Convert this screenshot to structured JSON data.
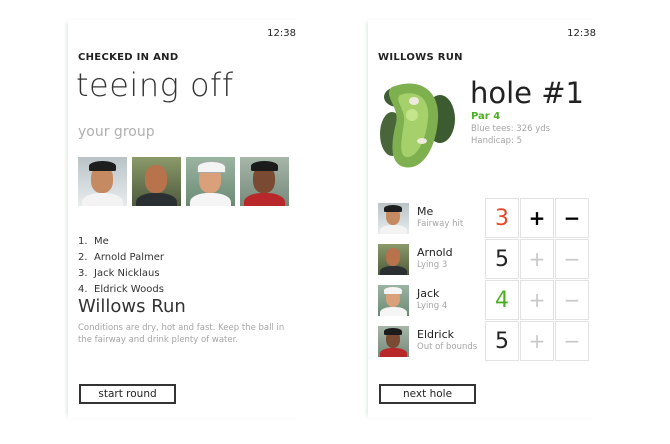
{
  "status": {
    "time": "12:38"
  },
  "screen1": {
    "app_title": "CHECKED IN AND",
    "page_title": "teeing off",
    "section_label": "your group",
    "players": [
      {
        "num": "1.",
        "name": "Me"
      },
      {
        "num": "2.",
        "name": "Arnold Palmer"
      },
      {
        "num": "3.",
        "name": "Jack Nicklaus"
      },
      {
        "num": "4.",
        "name": "Eldrick Woods"
      }
    ],
    "course_name": "Willows Run",
    "conditions": "Conditions are dry, hot and fast. Keep the ball in the fairway and drink plenty of water.",
    "start_button": "start round"
  },
  "screen2": {
    "app_title": "WILLOWS RUN",
    "hole_title": "hole #1",
    "par": "Par 4",
    "blue_tees": "Blue tees: 326 yds",
    "handicap": "Handicap: 5",
    "rows": [
      {
        "name": "Me",
        "status": "Fairway hit",
        "score": "3",
        "score_color": "#e8472a",
        "plus": "+",
        "minus": "−",
        "active": true
      },
      {
        "name": "Arnold",
        "status": "Lying 3",
        "score": "5",
        "score_color": "#222222",
        "plus": "+",
        "minus": "−",
        "active": false
      },
      {
        "name": "Jack",
        "status": "Lying 4",
        "score": "4",
        "score_color": "#4caf22",
        "plus": "+",
        "minus": "−",
        "active": false
      },
      {
        "name": "Eldrick",
        "status": "Out of bounds",
        "score": "5",
        "score_color": "#222222",
        "plus": "+",
        "minus": "−",
        "active": false
      }
    ],
    "next_button": "next hole"
  },
  "colors": {
    "accent_green": "#4caf22",
    "score_red": "#e8472a",
    "muted_text": "#a5a5a5"
  }
}
